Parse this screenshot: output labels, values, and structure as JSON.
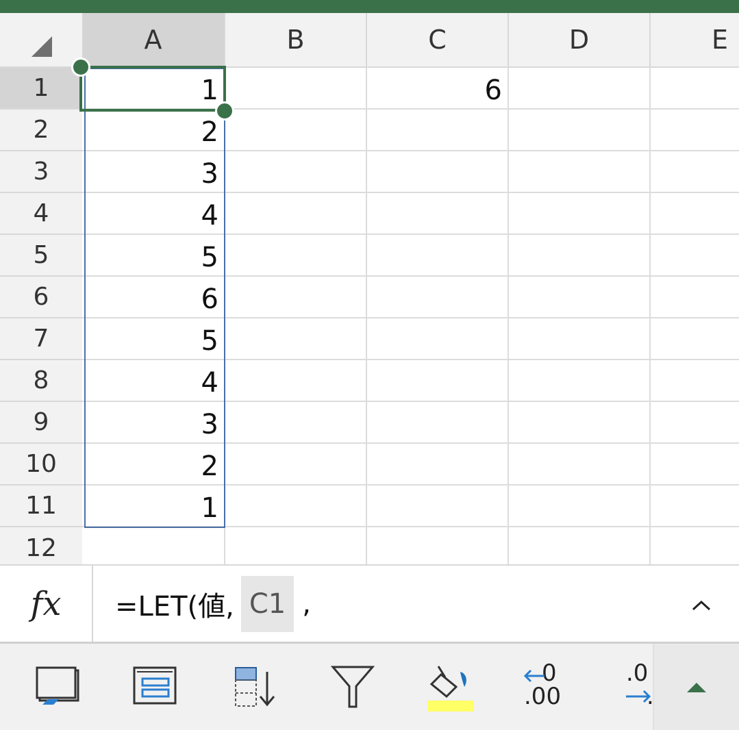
{
  "columns": [
    "A",
    "B",
    "C",
    "D",
    "E"
  ],
  "rows": [
    "1",
    "2",
    "3",
    "4",
    "5",
    "6",
    "7",
    "8",
    "9",
    "10",
    "11",
    "12"
  ],
  "colA": [
    "1",
    "2",
    "3",
    "4",
    "5",
    "6",
    "5",
    "4",
    "3",
    "2",
    "1"
  ],
  "colC": [
    "6"
  ],
  "formula": {
    "prefix": "=LET(値,",
    "highlighted_ref": "C1",
    "suffix": ","
  },
  "icons": {
    "fx": "fx",
    "expand": "chevron-up-icon",
    "freeze": "freeze-panes-icon",
    "group": "group-rows-icon",
    "sort": "sort-icon",
    "filter": "filter-icon",
    "fill": "fill-color-icon",
    "dec_inc": "decrease-decimal-icon",
    "dec_more": "increase-decimal-icon"
  },
  "toolbar": {
    "decimal_label_top": "0",
    "decimal_label_bottom": ".00",
    "decimal2_label_top": ".0",
    "decimal2_label_bottom": "."
  },
  "colors": {
    "accent": "#3a7149",
    "reference": "#4a6fa5",
    "fill_highlight": "#ffff66"
  }
}
